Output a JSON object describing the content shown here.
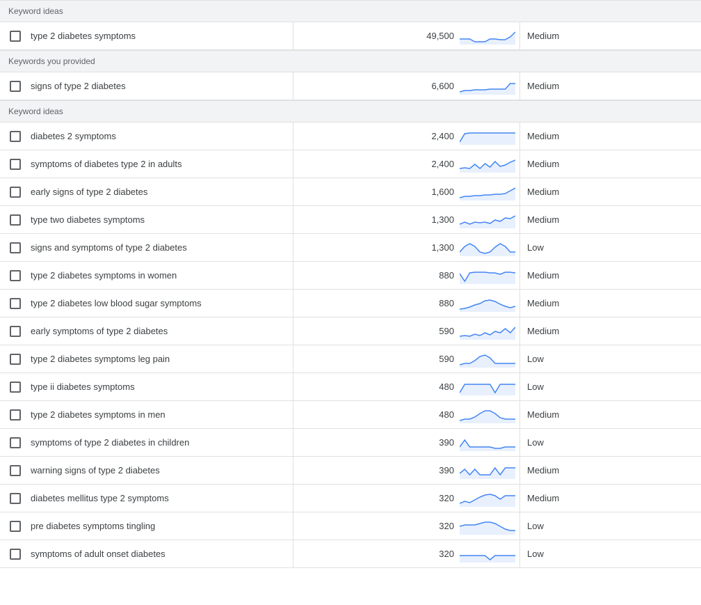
{
  "sections": [
    {
      "label": "Keyword ideas",
      "rows": [
        {
          "keyword": "type 2 diabetes symptoms",
          "volume": "49,500",
          "competition": "Medium",
          "spark": [
            16,
            16,
            16,
            20,
            20,
            20,
            16,
            16,
            17,
            17,
            13,
            6
          ]
        }
      ]
    },
    {
      "label": "Keywords you provided",
      "rows": [
        {
          "keyword": "signs of type 2 diabetes",
          "volume": "6,600",
          "competition": "Medium",
          "spark": [
            20,
            18,
            18,
            17,
            17,
            17,
            16,
            16,
            16,
            16,
            8,
            8
          ]
        }
      ]
    },
    {
      "label": "Keyword ideas",
      "rows": [
        {
          "keyword": "diabetes 2 symptoms",
          "volume": "2,400",
          "competition": "Medium",
          "spark": [
            20,
            8,
            7,
            7,
            7,
            7,
            7,
            7,
            7,
            7,
            7,
            7
          ]
        },
        {
          "keyword": "symptoms of diabetes type 2 in adults",
          "volume": "2,400",
          "competition": "Medium",
          "spark": [
            18,
            17,
            18,
            12,
            18,
            11,
            16,
            8,
            15,
            13,
            9,
            6
          ]
        },
        {
          "keyword": "early signs of type 2 diabetes",
          "volume": "1,600",
          "competition": "Medium",
          "spark": [
            20,
            18,
            18,
            17,
            17,
            16,
            16,
            15,
            15,
            14,
            10,
            6
          ]
        },
        {
          "keyword": "type two diabetes symptoms",
          "volume": "1,300",
          "competition": "Medium",
          "spark": [
            18,
            15,
            18,
            15,
            16,
            15,
            17,
            12,
            14,
            9,
            10,
            6
          ]
        },
        {
          "keyword": "signs and symptoms of type 2 diabetes",
          "volume": "1,300",
          "competition": "Low",
          "spark": [
            18,
            10,
            6,
            10,
            18,
            20,
            18,
            11,
            6,
            10,
            18,
            18
          ]
        },
        {
          "keyword": "type 2 diabetes symptoms in women",
          "volume": "880",
          "competition": "Medium",
          "spark": [
            9,
            20,
            8,
            7,
            7,
            7,
            8,
            8,
            10,
            7,
            7,
            8
          ]
        },
        {
          "keyword": "type 2 diabetes low blood sugar symptoms",
          "volume": "880",
          "competition": "Medium",
          "spark": [
            20,
            19,
            17,
            14,
            12,
            8,
            7,
            9,
            13,
            16,
            18,
            16
          ]
        },
        {
          "keyword": "early symptoms of type 2 diabetes",
          "volume": "590",
          "competition": "Medium",
          "spark": [
            19,
            18,
            19,
            16,
            18,
            14,
            17,
            12,
            14,
            8,
            14,
            6
          ]
        },
        {
          "keyword": "type 2 diabetes symptoms leg pain",
          "volume": "590",
          "competition": "Low",
          "spark": [
            20,
            18,
            18,
            14,
            8,
            6,
            10,
            18,
            18,
            18,
            18,
            18
          ]
        },
        {
          "keyword": "type ii diabetes symptoms",
          "volume": "480",
          "competition": "Low",
          "spark": [
            20,
            8,
            8,
            8,
            8,
            8,
            8,
            20,
            8,
            8,
            8,
            8
          ]
        },
        {
          "keyword": "type 2 diabetes symptoms in men",
          "volume": "480",
          "competition": "Medium",
          "spark": [
            20,
            18,
            18,
            15,
            10,
            6,
            6,
            10,
            16,
            18,
            18,
            18
          ]
        },
        {
          "keyword": "symptoms of type 2 diabetes in children",
          "volume": "390",
          "competition": "Low",
          "spark": [
            18,
            8,
            18,
            18,
            18,
            18,
            18,
            20,
            20,
            18,
            18,
            18
          ]
        },
        {
          "keyword": "warning signs of type 2 diabetes",
          "volume": "390",
          "competition": "Medium",
          "spark": [
            16,
            10,
            18,
            10,
            18,
            18,
            18,
            8,
            18,
            8,
            8,
            8
          ]
        },
        {
          "keyword": "diabetes mellitus type 2 symptoms",
          "volume": "320",
          "competition": "Medium",
          "spark": [
            19,
            16,
            18,
            14,
            10,
            7,
            6,
            8,
            13,
            8,
            8,
            8
          ]
        },
        {
          "keyword": "pre diabetes symptoms tingling",
          "volume": "320",
          "competition": "Low",
          "spark": [
            12,
            10,
            10,
            10,
            8,
            6,
            6,
            8,
            12,
            16,
            18,
            18
          ]
        },
        {
          "keyword": "symptoms of adult onset diabetes",
          "volume": "320",
          "competition": "Low",
          "spark": [
            14,
            14,
            14,
            14,
            14,
            14,
            20,
            14,
            14,
            14,
            14,
            14
          ]
        }
      ]
    }
  ]
}
